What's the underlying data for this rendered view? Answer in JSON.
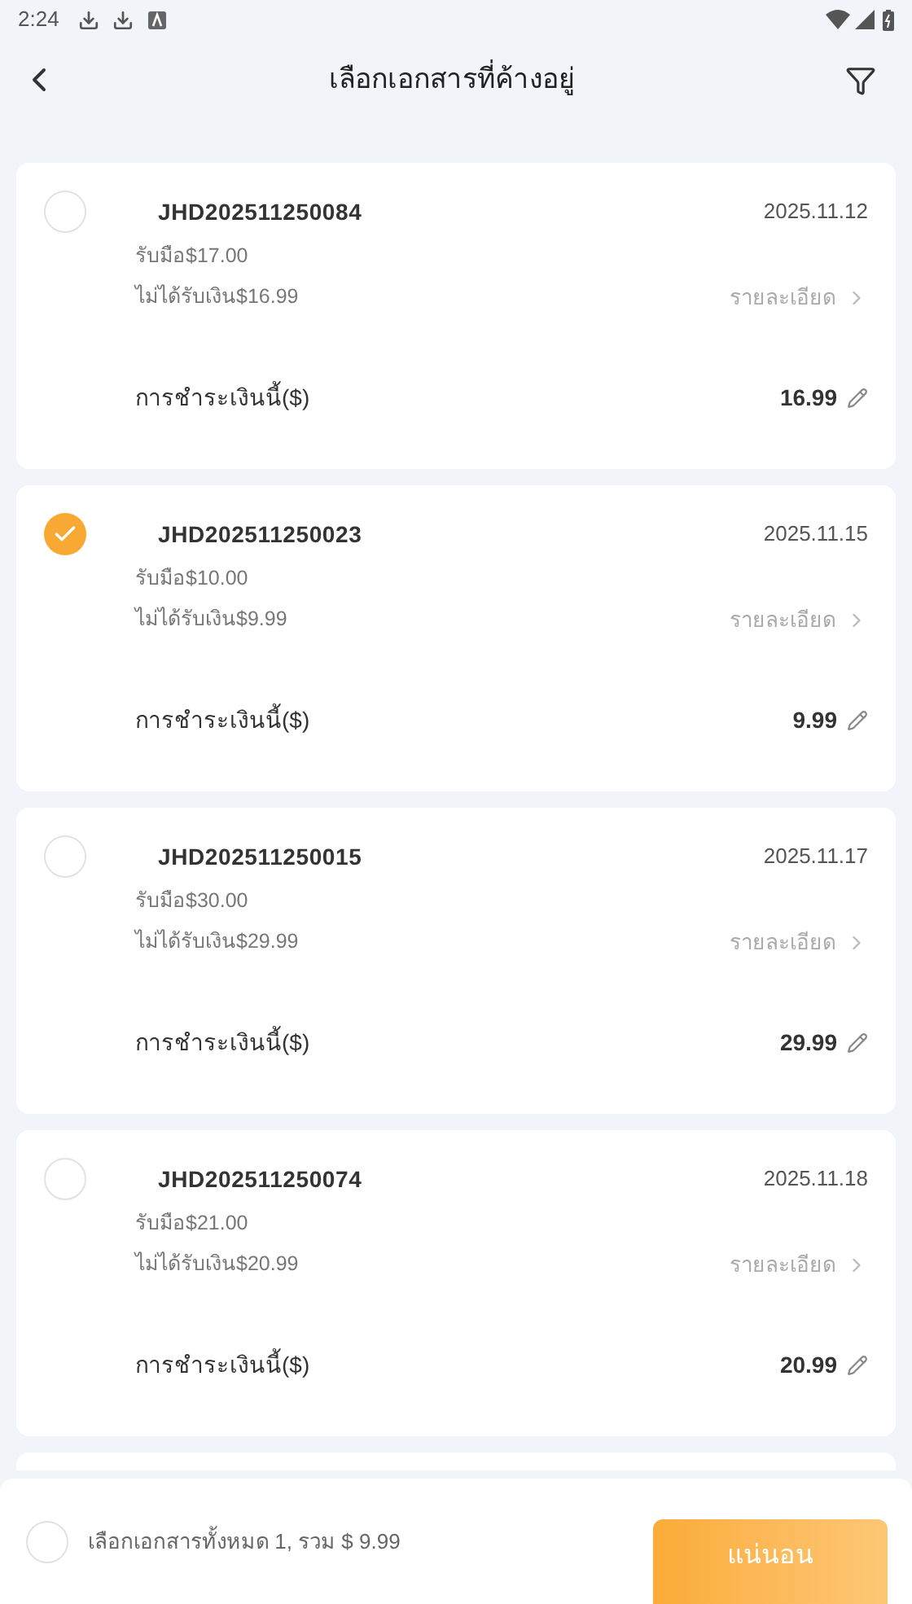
{
  "status_bar": {
    "time": "2:24"
  },
  "header": {
    "title": "เลือกเอกสารที่ค้างอยู่"
  },
  "documents": [
    {
      "id": "JHD202511250084",
      "date": "2025.11.12",
      "received": "รับมือ$17.00",
      "unpaid": "ไม่ได้รับเงิน$16.99",
      "details": "รายละเอียด",
      "payment_label": "การชำระเงินนี้($)",
      "payment": "16.99",
      "selected": false
    },
    {
      "id": "JHD202511250023",
      "date": "2025.11.15",
      "received": "รับมือ$10.00",
      "unpaid": "ไม่ได้รับเงิน$9.99",
      "details": "รายละเอียด",
      "payment_label": "การชำระเงินนี้($)",
      "payment": "9.99",
      "selected": true
    },
    {
      "id": "JHD202511250015",
      "date": "2025.11.17",
      "received": "รับมือ$30.00",
      "unpaid": "ไม่ได้รับเงิน$29.99",
      "details": "รายละเอียด",
      "payment_label": "การชำระเงินนี้($)",
      "payment": "29.99",
      "selected": false
    },
    {
      "id": "JHD202511250074",
      "date": "2025.11.18",
      "received": "รับมือ$21.00",
      "unpaid": "ไม่ได้รับเงิน$20.99",
      "details": "รายละเอียด",
      "payment_label": "การชำระเงินนี้($)",
      "payment": "20.99",
      "selected": false
    }
  ],
  "footer": {
    "select_all": {
      "checked": false
    },
    "summary": "เลือกเอกสารทั้งหมด 1, รวม $ 9.99",
    "confirm_button": "แน่นอน"
  }
}
